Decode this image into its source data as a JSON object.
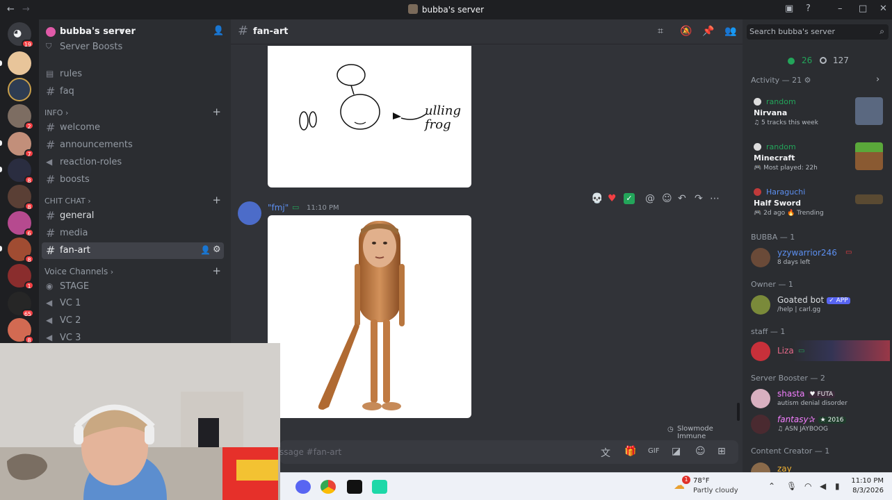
{
  "window": {
    "title": "bubba's server"
  },
  "server": {
    "name": "bubba's server",
    "partial_item": "Server Boosts",
    "top_channels": [
      "rules",
      "faq"
    ],
    "categories": {
      "info": "INFO",
      "chit_chat": "CHIT CHAT",
      "voice": "Voice Channels"
    },
    "info_channels": [
      "welcome",
      "announcements",
      "reaction-roles",
      "boosts"
    ],
    "chat_channels": [
      "general",
      "media",
      "fan-art"
    ],
    "voice_channels": [
      "STAGE",
      "VC 1",
      "VC 2",
      "VC 3"
    ],
    "rail_badges": [
      "19",
      "2",
      "7",
      "8",
      "8",
      "6",
      "8",
      "1",
      "65",
      "8"
    ]
  },
  "chat": {
    "channel": "fan-art",
    "message": {
      "author": "\"fmj\"",
      "time": "11:10 PM"
    },
    "slowmode": "Slowmode Immune",
    "composer_placeholder": "ssage #fan-art",
    "drawing_text": "ulling\nfrog"
  },
  "members": {
    "search_placeholder": "Search bubba's server",
    "online": "26",
    "offline": "127",
    "activity_header": "Activity — 21",
    "activities": [
      {
        "user": "random",
        "title": "Nirvana",
        "sub": "5 tracks this week"
      },
      {
        "user": "random",
        "title": "Minecraft",
        "sub": "Most played: 22h"
      },
      {
        "user": "Haraguchi",
        "title": "Half Sword",
        "sub": "2d ago",
        "extra": "Trending"
      }
    ],
    "groups": [
      {
        "header": "BUBBA — 1",
        "name": "yzywarrior246",
        "sub": "8 days left",
        "color": "#5c8ff0"
      },
      {
        "header": "Owner — 1",
        "name": "Goated bot",
        "tag": "APP",
        "sub": "/help | carl.gg",
        "color": "#dbdee1"
      },
      {
        "header": "staff — 1",
        "name": "Liza",
        "color": "#e86a8a"
      },
      {
        "header": "Server Booster — 2",
        "name": "shasta",
        "tag": "FUTA",
        "sub": "autism denial disorder",
        "color": "#f47fff"
      },
      {
        "name": "fantasy✰",
        "tag": "2016",
        "sub": "ASN JAYBOOG",
        "color": "#f47fff"
      },
      {
        "header": "Content Creator — 1",
        "name": "zay",
        "color": "#f0b232"
      }
    ]
  },
  "taskbar": {
    "weather_temp": "78°F",
    "weather_desc": "Partly cloudy",
    "weather_badge": "1",
    "time": "11:10 PM",
    "date": "8/3/2026"
  },
  "colors": {
    "accent": "#5865f2",
    "online": "#23a55a",
    "danger": "#f23f43"
  }
}
